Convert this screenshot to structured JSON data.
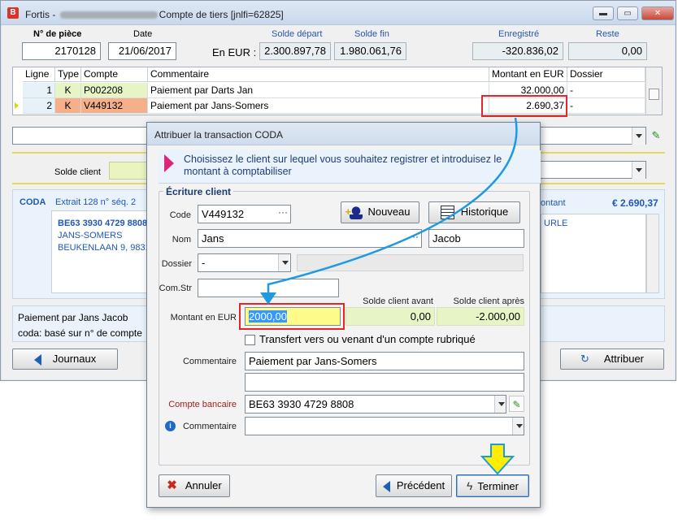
{
  "window": {
    "title_prefix": "Fortis - ",
    "title_suffix": "Compte de tiers [jnlfi=62825]",
    "min": "▬",
    "max": "▭",
    "close": "✕"
  },
  "header": {
    "piece_label": "N° de pièce",
    "piece_value": "2170128",
    "date_label": "Date",
    "date_value": "21/06/2017",
    "eur_label": "En EUR :",
    "solde_depart_label": "Solde départ",
    "solde_depart_value": "2.300.897,78",
    "solde_fin_label": "Solde fin",
    "solde_fin_value": "1.980.061,76",
    "enregistre_label": "Enregistré",
    "enregistre_value": "-320.836,02",
    "reste_label": "Reste",
    "reste_value": "0,00"
  },
  "grid": {
    "columns": [
      "Ligne",
      "Type",
      "Compte",
      "Commentaire",
      "Montant en EUR",
      "Dossier"
    ],
    "rows": [
      {
        "ligne": "1",
        "type": "K",
        "compte": "P002208",
        "commentaire": "Paiement par Darts Jan",
        "montant": "32.000,00",
        "dossier": "-"
      },
      {
        "ligne": "2",
        "type": "K",
        "compte": "V449132",
        "commentaire": "Paiement par Jans-Somers",
        "montant": "2.690,37",
        "dossier": "-"
      }
    ]
  },
  "behind": {
    "solde_client_label": "Solde client",
    "coda_label": "CODA",
    "extrait": "Extrait 128  n° séq. 2",
    "iban": "BE63 3930 4729 8808",
    "name": "JANS-SOMERS",
    "address": "BEUKENLAAN 9, 9831",
    "montant_label": "ontant",
    "montant_value": "€ 2.690,37",
    "urle": "URLE",
    "bottom_line1": "Paiement par Jans Jacob",
    "bottom_line2": "coda: basé sur n° de compte",
    "journaux_button": "Journaux",
    "attribuer_button": "Attribuer"
  },
  "dialog": {
    "title": "Attribuer la transaction CODA",
    "info": "Choisissez le client sur lequel vous souhaitez registrer et introduisez le montant à comptabiliser",
    "group_title": "Écriture client",
    "code_label": "Code",
    "code_value": "V449132",
    "nouveau_button": "Nouveau",
    "historique_button": "Historique",
    "nom_label": "Nom",
    "nom_value": "Jans",
    "prenom_value": "Jacob",
    "dossier_label": "Dossier",
    "dossier_value": "-",
    "comstr_label": "Com.Str",
    "comstr_value": "",
    "solde_avant_label": "Solde client avant",
    "solde_apres_label": "Solde client après",
    "montant_label": "Montant en EUR",
    "montant_value": "2000,00",
    "solde_avant_value": "0,00",
    "solde_apres_value": "-2.000,00",
    "transfert_label": "Transfert vers ou venant d'un compte rubriqué",
    "commentaire_label": "Commentaire",
    "commentaire_value": "Paiement par Jans-Somers",
    "commentaire2_value": "",
    "compte_bancaire_label": "Compte bancaire",
    "compte_bancaire_value": "BE63 3930 4729 8808",
    "commentaire3_label": "Commentaire",
    "commentaire3_value": "",
    "annuler_button": "Annuler",
    "precedent_button": "Précédent",
    "terminer_button": "Terminer"
  },
  "colors": {
    "accent_blue": "#2157b5",
    "highlight_red": "#e3262c",
    "arrow_blue": "#1e9be0",
    "arrow_yellow": "#ffee00"
  }
}
